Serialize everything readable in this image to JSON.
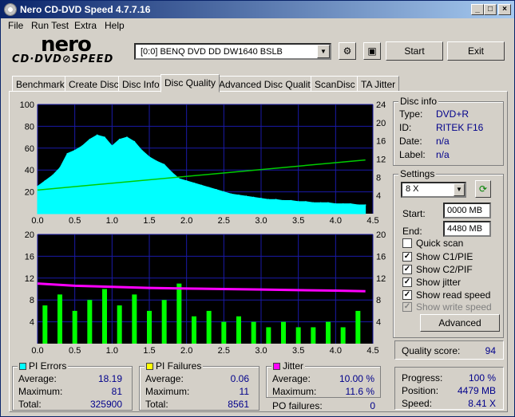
{
  "window": {
    "title": "Nero CD-DVD Speed 4.7.7.16"
  },
  "menu": [
    "File",
    "Run Test",
    "Extra",
    "Help"
  ],
  "logo": {
    "brand": "nero",
    "product": "CD·DVD⊘SPEED"
  },
  "toolbar": {
    "drive": "[0:0]   BENQ DVD DD DW1640 BSLB",
    "start": "Start",
    "exit": "Exit"
  },
  "tabs": [
    "Benchmark",
    "Create Disc",
    "Disc Info",
    "Disc Quality",
    "Advanced Disc Quality",
    "ScanDisc",
    "TA Jitter"
  ],
  "active_tab": "Disc Quality",
  "disc_info": {
    "title": "Disc info",
    "rows": [
      {
        "label": "Type:",
        "value": "DVD+R"
      },
      {
        "label": "ID:",
        "value": "RITEK F16"
      },
      {
        "label": "Date:",
        "value": "n/a"
      },
      {
        "label": "Label:",
        "value": "n/a"
      }
    ]
  },
  "settings": {
    "title": "Settings",
    "speed": "8 X",
    "start_label": "Start:",
    "start_value": "0000 MB",
    "end_label": "End:",
    "end_value": "4480 MB",
    "checks": [
      {
        "label": "Quick scan",
        "checked": false,
        "disabled": false
      },
      {
        "label": "Show C1/PIE",
        "checked": true,
        "disabled": false
      },
      {
        "label": "Show C2/PIF",
        "checked": true,
        "disabled": false
      },
      {
        "label": "Show jitter",
        "checked": true,
        "disabled": false
      },
      {
        "label": "Show read speed",
        "checked": true,
        "disabled": false
      },
      {
        "label": "Show write speed",
        "checked": true,
        "disabled": true
      }
    ],
    "advanced": "Advanced"
  },
  "quality": {
    "label": "Quality score:",
    "value": "94"
  },
  "progress": {
    "rows": [
      {
        "label": "Progress:",
        "value": "100 %"
      },
      {
        "label": "Position:",
        "value": "4479 MB"
      },
      {
        "label": "Speed:",
        "value": "8.41 X"
      }
    ]
  },
  "pi_errors": {
    "title": "PI Errors",
    "color": "#00ffff",
    "rows": [
      {
        "label": "Average:",
        "value": "18.19"
      },
      {
        "label": "Maximum:",
        "value": "81"
      },
      {
        "label": "Total:",
        "value": "325900"
      }
    ]
  },
  "pi_failures": {
    "title": "PI Failures",
    "color": "#ffff00",
    "rows": [
      {
        "label": "Average:",
        "value": "0.06"
      },
      {
        "label": "Maximum:",
        "value": "11"
      },
      {
        "label": "Total:",
        "value": "8561"
      }
    ]
  },
  "jitter": {
    "title": "Jitter",
    "color": "#ff00ff",
    "rows": [
      {
        "label": "Average:",
        "value": "10.00 %"
      },
      {
        "label": "Maximum:",
        "value": "11.6 %"
      }
    ],
    "po_label": "PO failures:",
    "po_value": "0"
  },
  "chart_data": [
    {
      "type": "area",
      "xlim": [
        0,
        4.5
      ],
      "ylim_left": [
        0,
        100
      ],
      "ylim_right": [
        0,
        24
      ],
      "x_ticks": [
        "0.0",
        "0.5",
        "1.0",
        "1.5",
        "2.0",
        "2.5",
        "3.0",
        "3.5",
        "4.0",
        "4.5"
      ],
      "y_ticks_left": [
        "100",
        "80",
        "60",
        "40",
        "20"
      ],
      "y_ticks_right": [
        "24",
        "20",
        "16",
        "12",
        "8",
        "4"
      ],
      "series": [
        {
          "name": "PI Errors",
          "color": "#00ffff",
          "x": [
            0.0,
            0.1,
            0.2,
            0.3,
            0.4,
            0.5,
            0.6,
            0.7,
            0.8,
            0.9,
            1.0,
            1.1,
            1.2,
            1.3,
            1.4,
            1.5,
            1.6,
            1.7,
            1.8,
            1.9,
            2.0,
            2.1,
            2.2,
            2.3,
            2.4,
            2.5,
            2.6,
            2.7,
            2.8,
            2.9,
            3.0,
            3.1,
            3.2,
            3.3,
            3.4,
            3.5,
            3.6,
            3.7,
            3.8,
            3.9,
            4.0,
            4.1,
            4.2,
            4.3,
            4.4
          ],
          "y": [
            25,
            30,
            35,
            42,
            55,
            58,
            62,
            68,
            72,
            70,
            62,
            68,
            70,
            66,
            58,
            52,
            48,
            45,
            38,
            32,
            30,
            28,
            26,
            24,
            22,
            20,
            18,
            17,
            16,
            15,
            14,
            13,
            13,
            12,
            12,
            11,
            11,
            10,
            10,
            10,
            9,
            9,
            9,
            8,
            8
          ]
        },
        {
          "name": "Read speed",
          "color": "#00cc00",
          "axis": "right",
          "x": [
            0.0,
            4.4
          ],
          "y": [
            5.2,
            11.8
          ]
        }
      ]
    },
    {
      "type": "bar",
      "xlim": [
        0,
        4.5
      ],
      "ylim_left": [
        0,
        20
      ],
      "ylim_right": [
        0,
        20
      ],
      "x_ticks": [
        "0.0",
        "0.5",
        "1.0",
        "1.5",
        "2.0",
        "2.5",
        "3.0",
        "3.5",
        "4.0",
        "4.5"
      ],
      "y_ticks_left": [
        "20",
        "16",
        "12",
        "8",
        "4"
      ],
      "y_ticks_right": [
        "20",
        "16",
        "12",
        "8",
        "4"
      ],
      "series": [
        {
          "name": "PI Failures",
          "color": "#00ff00",
          "x": [
            0.1,
            0.3,
            0.5,
            0.7,
            0.9,
            1.1,
            1.3,
            1.5,
            1.7,
            1.9,
            2.1,
            2.3,
            2.5,
            2.7,
            2.9,
            3.1,
            3.3,
            3.5,
            3.7,
            3.9,
            4.1,
            4.3
          ],
          "y": [
            7,
            9,
            6,
            8,
            10,
            7,
            9,
            6,
            8,
            11,
            5,
            6,
            4,
            5,
            4,
            3,
            4,
            3,
            3,
            4,
            3,
            6
          ]
        },
        {
          "name": "Jitter",
          "color": "#ff00ff",
          "x": [
            0.0,
            0.5,
            1.0,
            1.5,
            2.0,
            2.5,
            3.0,
            3.5,
            4.0,
            4.4
          ],
          "y": [
            11.0,
            10.6,
            10.4,
            10.2,
            10.1,
            10.0,
            9.9,
            9.8,
            9.7,
            9.6
          ]
        }
      ]
    }
  ]
}
